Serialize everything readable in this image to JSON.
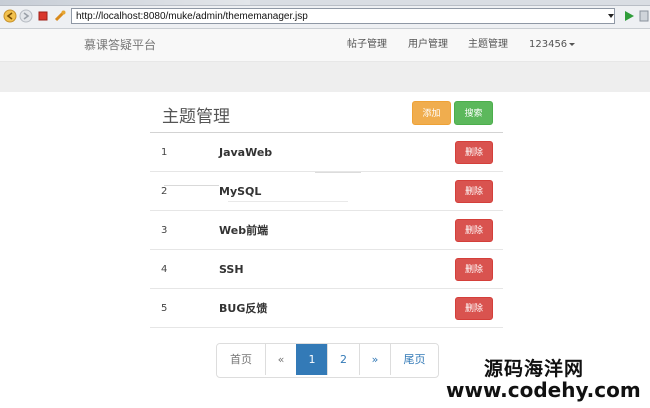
{
  "browser": {
    "url": "http://localhost:8080/muke/admin/thememanager.jsp"
  },
  "navbar": {
    "brand": "慕课答疑平台",
    "items": [
      {
        "label": "帖子管理"
      },
      {
        "label": "用户管理"
      },
      {
        "label": "主题管理"
      }
    ],
    "user": "123456"
  },
  "panel": {
    "title": "主题管理",
    "add_label": "添加",
    "search_label": "搜索",
    "delete_label": "删除",
    "rows": [
      {
        "idx": "1",
        "name": "JavaWeb"
      },
      {
        "idx": "2",
        "name": "MySQL"
      },
      {
        "idx": "3",
        "name": "Web前端"
      },
      {
        "idx": "4",
        "name": "SSH"
      },
      {
        "idx": "5",
        "name": "BUG反馈"
      }
    ]
  },
  "pagination": {
    "first": "首页",
    "prev": "«",
    "pages": [
      "1",
      "2"
    ],
    "current": "1",
    "next": "»",
    "last": "尾页"
  },
  "watermark": {
    "name": "源码海洋网",
    "url": "www.codehy.com"
  },
  "colors": {
    "primary": "#337ab7",
    "warning": "#f0ad4e",
    "success": "#5cb85c",
    "danger": "#d9534f"
  }
}
